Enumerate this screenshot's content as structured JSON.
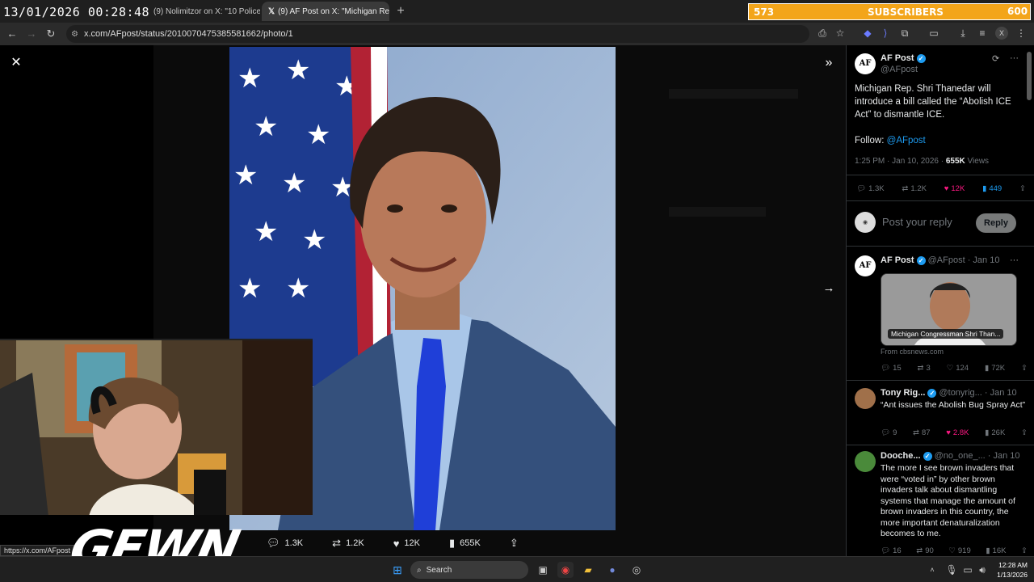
{
  "overlay": {
    "timestamp": "13/01/2026 00:28:48",
    "subs_current": "573",
    "subs_label": "SUBSCRIBERS",
    "subs_goal": "600",
    "logo_text": "GEWN"
  },
  "browser": {
    "tabs": [
      {
        "label": "(9) Nolimitzor on X: \"10 Police"
      },
      {
        "label": "(9) AF Post on X: \"Michigan Re"
      }
    ],
    "url": "x.com/AFpost/status/2010070475385581662/photo/1",
    "status_url": "https://x.com/AFpost"
  },
  "viewer": {
    "actions": {
      "replies": "1.3K",
      "reposts": "1.2K",
      "likes": "12K",
      "views": "655K"
    }
  },
  "post": {
    "name": "AF Post",
    "handle": "@AFpost",
    "avatar_text": "AF",
    "text": "Michigan Rep. Shri Thanedar will introduce a bill called the “Abolish ICE Act” to dismantle ICE.",
    "follow_prefix": "Follow:",
    "follow_link": "@AFpost",
    "time": "1:25 PM · Jan 10, 2026 ·",
    "views_count": "655K",
    "views_label": "Views",
    "replies": "1.3K",
    "reposts": "1.2K",
    "likes": "12K",
    "bookmarks": "449",
    "reply_placeholder": "Post your reply",
    "reply_button": "Reply"
  },
  "replies": [
    {
      "name": "AF Post",
      "handle": "@AFpost · Jan 10",
      "avatar_text": "AF",
      "card_caption": "Michigan Congressman Shri Than...",
      "card_source": "From cbsnews.com",
      "stats": [
        "15",
        "3",
        "124",
        "72K"
      ]
    },
    {
      "name": "Tony Rig...",
      "handle": "@tonyrig... · Jan 10",
      "text": "“Ant issues the Abolish Bug Spray Act”",
      "stats": [
        "9",
        "87",
        "2.8K",
        "26K"
      ]
    },
    {
      "name": "Dooche...",
      "handle": "@no_one_... · Jan 10",
      "text": "The more I see brown invaders that were “voted in” by other brown invaders talk about dismantling systems that manage the amount of brown invaders in this country, the more important denaturalization becomes to me.",
      "stats": [
        "16",
        "90",
        "919",
        "16K"
      ]
    }
  ],
  "taskbar": {
    "search_label": "Search",
    "time": "12:28 AM",
    "date": "1/13/2026"
  }
}
